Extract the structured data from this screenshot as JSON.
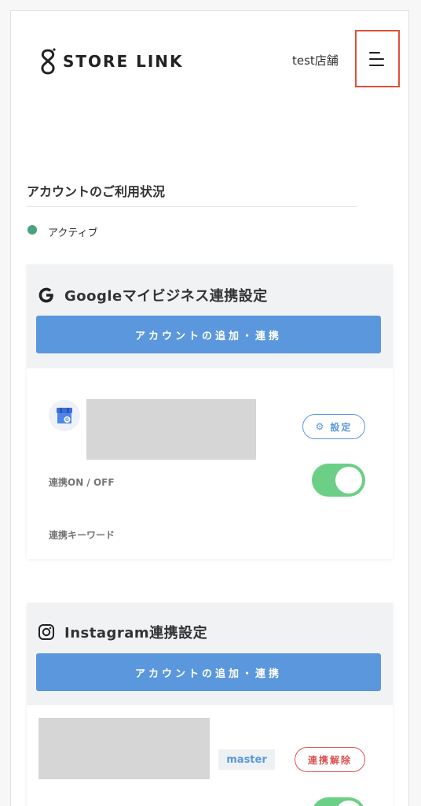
{
  "header": {
    "logo_text": "STORE LINK",
    "store_name": "test店舗",
    "menu_icon": "menu-icon"
  },
  "account_status": {
    "title": "アカウントのご利用状況",
    "status": "アクティブ",
    "status_color": "#4aa37e"
  },
  "google": {
    "title": "Googleマイビジネス連携設定",
    "add_button": "アカウントの追加・連携",
    "settings_button": "設定",
    "toggle_label": "連携ON / OFF",
    "toggle_on": true,
    "keyword_label": "連携キーワード"
  },
  "instagram": {
    "title": "Instagram連携設定",
    "add_button": "アカウントの追加・連携",
    "badge": "master",
    "unlink_button": "連携解除"
  },
  "colors": {
    "accent_blue": "#5b97dd",
    "toggle_green": "#6bcf86",
    "danger_red": "#d9534f",
    "menu_highlight": "#e0503a"
  }
}
